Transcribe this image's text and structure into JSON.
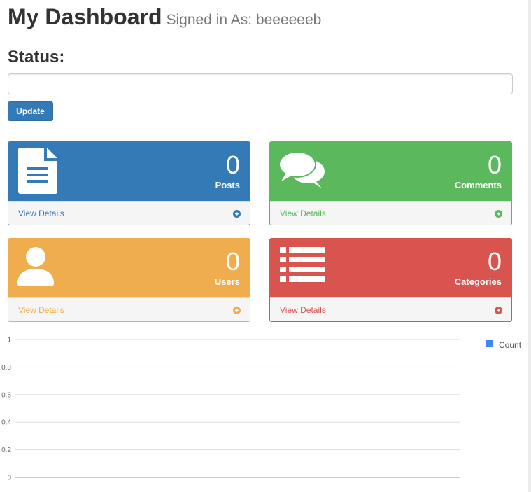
{
  "header": {
    "title": "My Dashboard",
    "subtitle": "Signed in As: beeeeeeb"
  },
  "status": {
    "title": "Status:",
    "input_value": "",
    "placeholder": "",
    "update_label": "Update"
  },
  "panels": [
    {
      "count": "0",
      "label": "Posts",
      "link": "View Details",
      "icon": "document-icon",
      "color": "#337ab7"
    },
    {
      "count": "0",
      "label": "Comments",
      "link": "View Details",
      "icon": "comments-icon",
      "color": "#5cb85c"
    },
    {
      "count": "0",
      "label": "Users",
      "link": "View Details",
      "icon": "user-icon",
      "color": "#f0ad4e"
    },
    {
      "count": "0",
      "label": "Categories",
      "link": "View Details",
      "icon": "list-icon",
      "color": "#d9534f"
    }
  ],
  "chart_data": {
    "type": "bar",
    "categories": [],
    "series": [
      {
        "name": "Count",
        "values": [],
        "color": "#4285f4"
      }
    ],
    "yticks": [
      "0",
      "0.2",
      "0.4",
      "0.6",
      "0.8",
      "1"
    ],
    "ylim": [
      0,
      1
    ],
    "grid": true,
    "legend": "right"
  }
}
